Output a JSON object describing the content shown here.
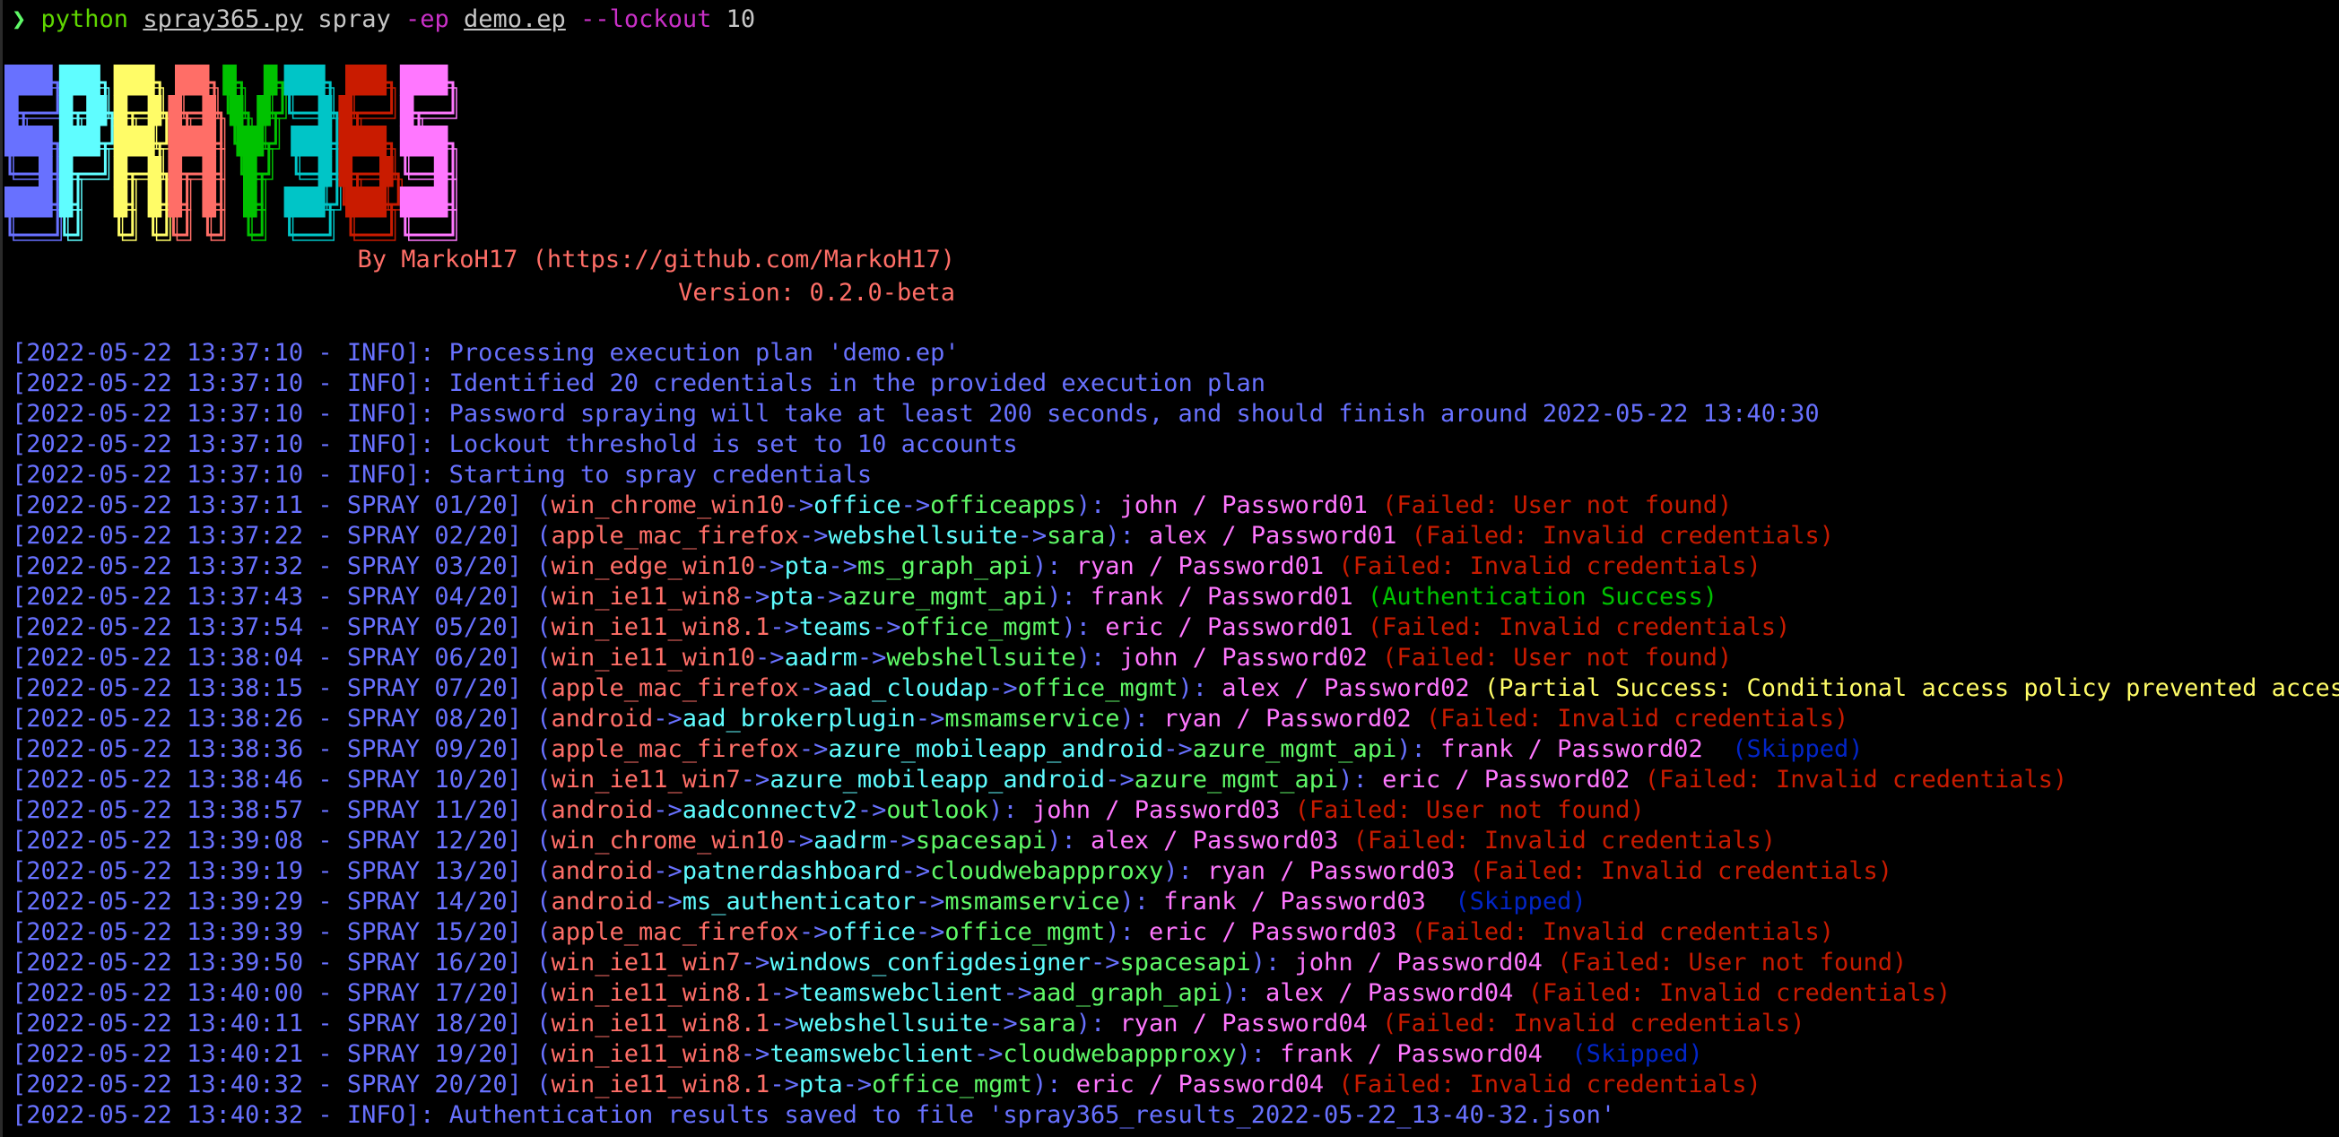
{
  "command": {
    "prompt": "❯",
    "program": "python",
    "script": "spray365.py",
    "subcommand": "spray",
    "flag_ep": "-ep",
    "ep_file": "demo.ep",
    "flag_lockout": "--lockout",
    "lockout_value": "10"
  },
  "banner": {
    "logo_text": "SPRAY365",
    "logo_colors": [
      "#6871ff",
      "#5ffdff",
      "#fffc67",
      "#ff6e67",
      "#00c200",
      "#00c5c7",
      "#c91b00",
      "#ff77ff"
    ],
    "byline": "By MarkoH17 (https://github.com/MarkoH17)",
    "version": "Version: 0.2.0-beta"
  },
  "colors": {
    "info": "#6871ff",
    "chain_1": "#ff6e67",
    "chain_2": "#5ffdff",
    "chain_3": "#5ff967",
    "credential": "#ff77ff",
    "failed": "#c91b00",
    "success": "#00c200",
    "partial": "#fffc67",
    "skipped": "#0225c7"
  },
  "log": [
    {
      "type": "info",
      "prefix": "[2022-05-22 13:37:10 - INFO]: ",
      "message": "Processing execution plan 'demo.ep'"
    },
    {
      "type": "info",
      "prefix": "[2022-05-22 13:37:10 - INFO]: ",
      "message": "Identified 20 credentials in the provided execution plan"
    },
    {
      "type": "info",
      "prefix": "[2022-05-22 13:37:10 - INFO]: ",
      "message": "Password spraying will take at least 200 seconds, and should finish around 2022-05-22 13:40:30"
    },
    {
      "type": "info",
      "prefix": "[2022-05-22 13:37:10 - INFO]: ",
      "message": "Lockout threshold is set to 10 accounts"
    },
    {
      "type": "info",
      "prefix": "[2022-05-22 13:37:10 - INFO]: ",
      "message": "Starting to spray credentials"
    },
    {
      "type": "spray",
      "prefix": "[2022-05-22 13:37:11 - SPRAY 01/20]",
      "chain": [
        "win_chrome_win10",
        "office",
        "officeapps"
      ],
      "user": "john",
      "password": "Password01",
      "result": "(Failed: User not found)",
      "status": "failed"
    },
    {
      "type": "spray",
      "prefix": "[2022-05-22 13:37:22 - SPRAY 02/20]",
      "chain": [
        "apple_mac_firefox",
        "webshellsuite",
        "sara"
      ],
      "user": "alex",
      "password": "Password01",
      "result": "(Failed: Invalid credentials)",
      "status": "failed"
    },
    {
      "type": "spray",
      "prefix": "[2022-05-22 13:37:32 - SPRAY 03/20]",
      "chain": [
        "win_edge_win10",
        "pta",
        "ms_graph_api"
      ],
      "user": "ryan",
      "password": "Password01",
      "result": "(Failed: Invalid credentials)",
      "status": "failed"
    },
    {
      "type": "spray",
      "prefix": "[2022-05-22 13:37:43 - SPRAY 04/20]",
      "chain": [
        "win_ie11_win8",
        "pta",
        "azure_mgmt_api"
      ],
      "user": "frank",
      "password": "Password01",
      "result": "(Authentication Success)",
      "status": "success"
    },
    {
      "type": "spray",
      "prefix": "[2022-05-22 13:37:54 - SPRAY 05/20]",
      "chain": [
        "win_ie11_win8.1",
        "teams",
        "office_mgmt"
      ],
      "user": "eric",
      "password": "Password01",
      "result": "(Failed: Invalid credentials)",
      "status": "failed"
    },
    {
      "type": "spray",
      "prefix": "[2022-05-22 13:38:04 - SPRAY 06/20]",
      "chain": [
        "win_ie11_win10",
        "aadrm",
        "webshellsuite"
      ],
      "user": "john",
      "password": "Password02",
      "result": "(Failed: User not found)",
      "status": "failed"
    },
    {
      "type": "spray",
      "prefix": "[2022-05-22 13:38:15 - SPRAY 07/20]",
      "chain": [
        "apple_mac_firefox",
        "aad_cloudap",
        "office_mgmt"
      ],
      "user": "alex",
      "password": "Password02",
      "result": "(Partial Success: Conditional access policy prevented access)",
      "status": "partial"
    },
    {
      "type": "spray",
      "prefix": "[2022-05-22 13:38:26 - SPRAY 08/20]",
      "chain": [
        "android",
        "aad_brokerplugin",
        "msmamservice"
      ],
      "user": "ryan",
      "password": "Password02",
      "result": "(Failed: Invalid credentials)",
      "status": "failed"
    },
    {
      "type": "spray",
      "prefix": "[2022-05-22 13:38:36 - SPRAY 09/20]",
      "chain": [
        "apple_mac_firefox",
        "azure_mobileapp_android",
        "azure_mgmt_api"
      ],
      "user": "frank",
      "password": "Password02",
      "result": " (Skipped)",
      "status": "skipped"
    },
    {
      "type": "spray",
      "prefix": "[2022-05-22 13:38:46 - SPRAY 10/20]",
      "chain": [
        "win_ie11_win7",
        "azure_mobileapp_android",
        "azure_mgmt_api"
      ],
      "user": "eric",
      "password": "Password02",
      "result": "(Failed: Invalid credentials)",
      "status": "failed"
    },
    {
      "type": "spray",
      "prefix": "[2022-05-22 13:38:57 - SPRAY 11/20]",
      "chain": [
        "android",
        "aadconnectv2",
        "outlook"
      ],
      "user": "john",
      "password": "Password03",
      "result": "(Failed: User not found)",
      "status": "failed"
    },
    {
      "type": "spray",
      "prefix": "[2022-05-22 13:39:08 - SPRAY 12/20]",
      "chain": [
        "win_chrome_win10",
        "aadrm",
        "spacesapi"
      ],
      "user": "alex",
      "password": "Password03",
      "result": "(Failed: Invalid credentials)",
      "status": "failed"
    },
    {
      "type": "spray",
      "prefix": "[2022-05-22 13:39:19 - SPRAY 13/20]",
      "chain": [
        "android",
        "patnerdashboard",
        "cloudwebappproxy"
      ],
      "user": "ryan",
      "password": "Password03",
      "result": "(Failed: Invalid credentials)",
      "status": "failed"
    },
    {
      "type": "spray",
      "prefix": "[2022-05-22 13:39:29 - SPRAY 14/20]",
      "chain": [
        "android",
        "ms_authenticator",
        "msmamservice"
      ],
      "user": "frank",
      "password": "Password03",
      "result": " (Skipped)",
      "status": "skipped"
    },
    {
      "type": "spray",
      "prefix": "[2022-05-22 13:39:39 - SPRAY 15/20]",
      "chain": [
        "apple_mac_firefox",
        "office",
        "office_mgmt"
      ],
      "user": "eric",
      "password": "Password03",
      "result": "(Failed: Invalid credentials)",
      "status": "failed"
    },
    {
      "type": "spray",
      "prefix": "[2022-05-22 13:39:50 - SPRAY 16/20]",
      "chain": [
        "win_ie11_win7",
        "windows_configdesigner",
        "spacesapi"
      ],
      "user": "john",
      "password": "Password04",
      "result": "(Failed: User not found)",
      "status": "failed"
    },
    {
      "type": "spray",
      "prefix": "[2022-05-22 13:40:00 - SPRAY 17/20]",
      "chain": [
        "win_ie11_win8.1",
        "teamswebclient",
        "aad_graph_api"
      ],
      "user": "alex",
      "password": "Password04",
      "result": "(Failed: Invalid credentials)",
      "status": "failed"
    },
    {
      "type": "spray",
      "prefix": "[2022-05-22 13:40:11 - SPRAY 18/20]",
      "chain": [
        "win_ie11_win8.1",
        "webshellsuite",
        "sara"
      ],
      "user": "ryan",
      "password": "Password04",
      "result": "(Failed: Invalid credentials)",
      "status": "failed"
    },
    {
      "type": "spray",
      "prefix": "[2022-05-22 13:40:21 - SPRAY 19/20]",
      "chain": [
        "win_ie11_win8",
        "teamswebclient",
        "cloudwebappproxy"
      ],
      "user": "frank",
      "password": "Password04",
      "result": " (Skipped)",
      "status": "skipped"
    },
    {
      "type": "spray",
      "prefix": "[2022-05-22 13:40:32 - SPRAY 20/20]",
      "chain": [
        "win_ie11_win8.1",
        "pta",
        "office_mgmt"
      ],
      "user": "eric",
      "password": "Password04",
      "result": "(Failed: Invalid credentials)",
      "status": "failed"
    },
    {
      "type": "info",
      "prefix": "[2022-05-22 13:40:32 - INFO]: ",
      "message": "Authentication results saved to file 'spray365_results_2022-05-22_13-40-32.json'"
    }
  ]
}
